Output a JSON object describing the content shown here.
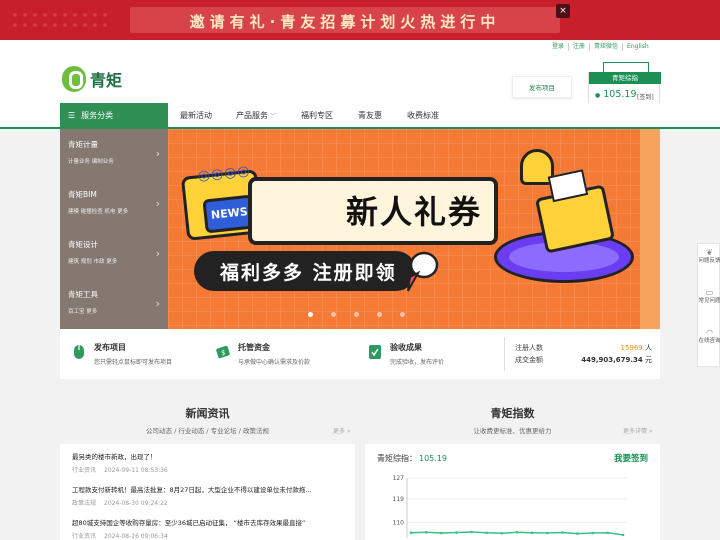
{
  "promo": {
    "text": "邀请有礼·青友招募计划火热进行中",
    "close": "×"
  },
  "toplinks": [
    "登录",
    "注册",
    "青矩微信",
    "English"
  ],
  "brand": {
    "name": "青矩"
  },
  "header": {
    "publish_button": "发布项目",
    "index_tab": "青矩综指",
    "index_value": "105.19",
    "sign": "[签到]"
  },
  "nav": {
    "category_label": "服务分类",
    "items": [
      "最新活动",
      "产品服务",
      "福利专区",
      "青友惠",
      "收费标准"
    ]
  },
  "sidebar": [
    {
      "title": "青矩计量",
      "sub": "计量业务 编制业务"
    },
    {
      "title": "青矩BIM",
      "sub": "建模 碰撞检查 机电 更多"
    },
    {
      "title": "青矩设计",
      "sub": "建筑 规划 市政 更多"
    },
    {
      "title": "青矩工具",
      "sub": "百工宝 更多"
    }
  ],
  "hero": {
    "news_tag": "NEWS",
    "title": "新人礼券",
    "subtitle": "福利多多 注册即领",
    "active_slide": 1,
    "slide_count": 5
  },
  "steps": [
    {
      "title": "发布项目",
      "desc": "您只需轻点鼠标即可发布项目"
    },
    {
      "title": "托管资金",
      "desc": "与承做中心确认需求及价款"
    },
    {
      "title": "验收成果",
      "desc": "完成验收，发布评价"
    }
  ],
  "stats": {
    "users_label": "注册人数",
    "users_value": "15969",
    "users_unit": "人",
    "amount_label": "成交金额",
    "amount_value": "449,903,679.34",
    "amount_unit": "元"
  },
  "news_section": {
    "title": "新闻资讯",
    "subtitle": "公司动态 / 行业动态 / 专业论坛 / 政策法规",
    "more": "更多 »",
    "items": [
      {
        "title": "最另类的楼市新政，出现了！",
        "category": "行业资讯",
        "date": "2024-09-11 08:53:36"
      },
      {
        "title": "工程款支付新转机！最高法批复：8月27日起，大型企业不得以建设单位未付款拖...",
        "category": "政策法规",
        "date": "2024-08-30 09:24:22"
      },
      {
        "title": "超80城支持国企等收购存量房：至少36城已启动征集， “楼市去库存效果最直接”",
        "category": "行业资讯",
        "date": "2024-08-26 09:06:34"
      }
    ]
  },
  "index_section": {
    "title": "青矩指数",
    "subtitle": "让收费更标准、优惠更给力",
    "more": "更多详情 »",
    "label": "青矩综指：",
    "value": "105.19",
    "sign": "我要签到"
  },
  "chart_data": {
    "type": "line",
    "yticks": [
      "127",
      "119",
      "110"
    ],
    "ylim": [
      104,
      127
    ],
    "series": [
      {
        "values": [
          106,
          106.2,
          105.9,
          106.1,
          106.3,
          106.0,
          105.8,
          106.2,
          106.0,
          105.9,
          106.1,
          105.7,
          105.9,
          106.0,
          105.2
        ]
      }
    ],
    "color": "#39c08a"
  },
  "float_tools": [
    {
      "icon": "leaf-icon",
      "label": "问题反馈"
    },
    {
      "icon": "chat-icon",
      "label": "常见问题"
    },
    {
      "icon": "headset-icon",
      "label": "在线咨询"
    }
  ],
  "colors": {
    "brand_green": "#1d8f54",
    "promo_red": "#c8202a",
    "hero_orange": "#f47a36",
    "accent_orange": "#f28a1a"
  }
}
